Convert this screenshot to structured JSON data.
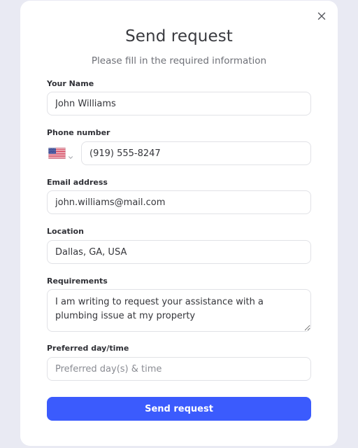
{
  "modal": {
    "title": "Send request",
    "subtitle": "Please fill in the required information",
    "close_icon": "close-icon"
  },
  "form": {
    "name": {
      "label": "Your Name",
      "value": "John Williams"
    },
    "phone": {
      "label": "Phone number",
      "value": "(919) 555-8247",
      "country_icon": "us-flag-icon"
    },
    "email": {
      "label": "Email address",
      "value": "john.williams@mail.com"
    },
    "location": {
      "label": "Location",
      "value": "Dallas, GA, USA"
    },
    "requirements": {
      "label": "Requirements",
      "value": "I am writing to request your assistance with a plumbing issue at my property"
    },
    "preferred": {
      "label": "Preferred day/time",
      "value": "",
      "placeholder": "Preferred day(s) & time"
    }
  },
  "submit_label": "Send request",
  "colors": {
    "accent": "#3b5bfd",
    "background": "#e9eaf3",
    "card": "#ffffff"
  }
}
